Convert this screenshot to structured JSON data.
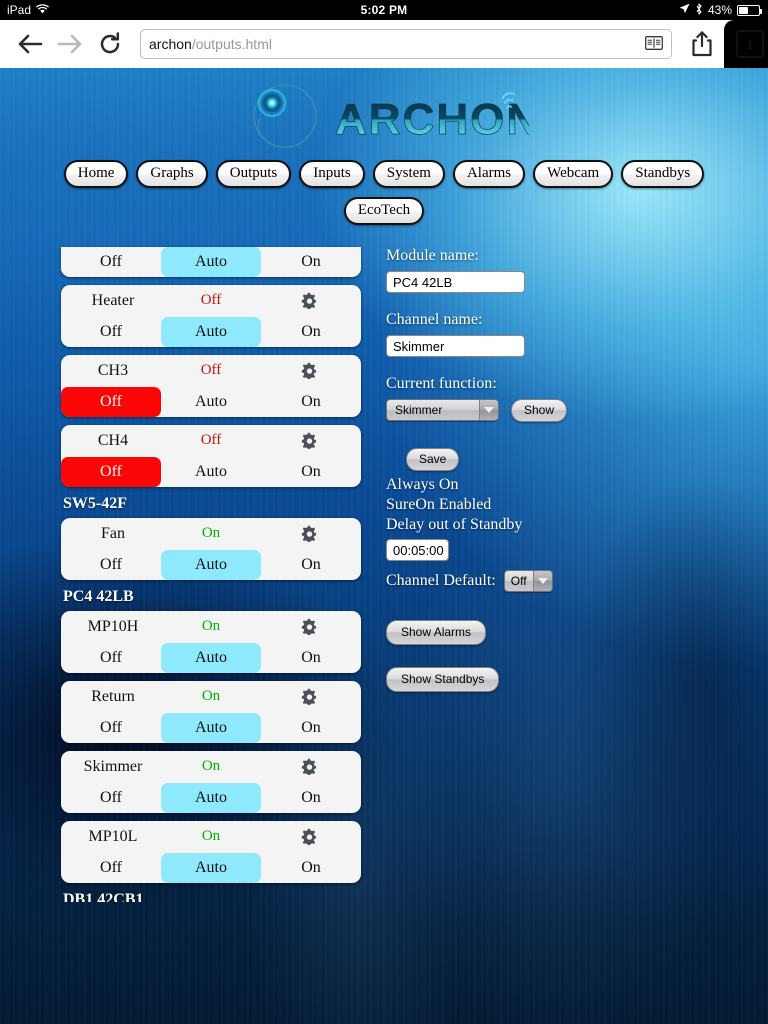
{
  "status_bar": {
    "device": "iPad",
    "wifi_icon": "wifi-icon",
    "time": "5:02 PM",
    "location_icon": "location-arrow-icon",
    "bluetooth_icon": "bluetooth-icon",
    "battery_percent": "43%",
    "battery_level": 43
  },
  "browser": {
    "back_icon": "back-arrow-icon",
    "forward_icon": "forward-arrow-icon",
    "reload_icon": "reload-icon",
    "url_host": "archon",
    "url_path": "/outputs.html",
    "reader_icon": "reader-view-icon",
    "share_icon": "share-icon",
    "bookmark_icon": "star-icon",
    "tab_count": "1"
  },
  "logo": {
    "wordmark": "ARCHON",
    "mark_icon": "archon-circle-logo",
    "signal_icon": "wifi-signal-icon"
  },
  "nav": {
    "row1": [
      {
        "label": "Home"
      },
      {
        "label": "Graphs"
      },
      {
        "label": "Outputs"
      },
      {
        "label": "Inputs"
      },
      {
        "label": "System"
      },
      {
        "label": "Alarms"
      },
      {
        "label": "Webcam"
      },
      {
        "label": "Standbys"
      }
    ],
    "row2": [
      {
        "label": "EcoTech"
      }
    ]
  },
  "outputs": {
    "mode_labels": {
      "off": "Off",
      "auto": "Auto",
      "on": "On"
    },
    "gear_icon": "gear-icon",
    "items": [
      {
        "kind": "card",
        "partial": true,
        "name": "",
        "status": "",
        "selected": "auto"
      },
      {
        "kind": "card",
        "partial": false,
        "name": "Heater",
        "status": "Off",
        "status_state": "off",
        "selected": "auto"
      },
      {
        "kind": "card",
        "partial": false,
        "name": "CH3",
        "status": "Off",
        "status_state": "off",
        "selected": "off"
      },
      {
        "kind": "card",
        "partial": false,
        "name": "CH4",
        "status": "Off",
        "status_state": "off",
        "selected": "off"
      },
      {
        "kind": "section",
        "label": "SW5-42F"
      },
      {
        "kind": "card",
        "partial": false,
        "name": "Fan",
        "status": "On",
        "status_state": "on",
        "selected": "auto"
      },
      {
        "kind": "section",
        "label": "PC4 42LB"
      },
      {
        "kind": "card",
        "partial": false,
        "name": "MP10H",
        "status": "On",
        "status_state": "on",
        "selected": "auto"
      },
      {
        "kind": "card",
        "partial": false,
        "name": "Return",
        "status": "On",
        "status_state": "on",
        "selected": "auto"
      },
      {
        "kind": "card",
        "partial": false,
        "name": "Skimmer",
        "status": "On",
        "status_state": "on",
        "selected": "auto"
      },
      {
        "kind": "card",
        "partial": false,
        "name": "MP10L",
        "status": "On",
        "status_state": "on",
        "selected": "auto"
      },
      {
        "kind": "section",
        "label": "DB1 42CB1",
        "clipped": true
      }
    ]
  },
  "form": {
    "module_name_label": "Module name:",
    "module_name_value": "PC4 42LB",
    "channel_name_label": "Channel name:",
    "channel_name_value": "Skimmer",
    "current_function_label": "Current function:",
    "current_function_value": "Skimmer",
    "show_button": "Show",
    "save_button": "Save",
    "info_lines": [
      "Always On",
      "SureOn Enabled",
      "Delay out of Standby"
    ],
    "delay_value": "00:05:00",
    "channel_default_label": "Channel Default:",
    "channel_default_value": "Off",
    "show_alarms_button": "Show Alarms",
    "show_standbys_button": "Show Standbys",
    "dropdown_icon": "chevron-down-icon"
  },
  "colors": {
    "auto_selected": "#8de9fb",
    "off_selected": "#fb0606",
    "status_on": "#00b300",
    "status_off": "#cc1111",
    "card_bg": "#f4f4f4"
  }
}
